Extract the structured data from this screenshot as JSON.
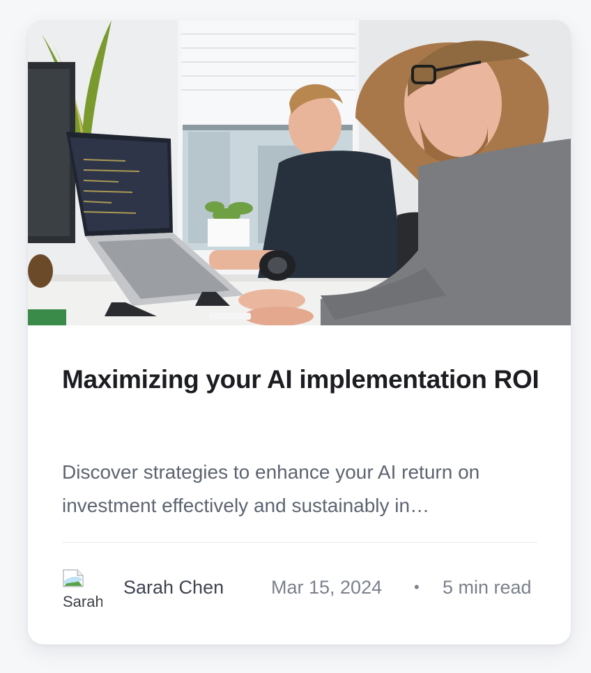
{
  "card": {
    "image_alt": "Two developers working at desks with laptops and monitors",
    "title": "Maximizing your AI implementation ROI",
    "excerpt": "Discover strategies to enhance your AI return on investment effectively and sustainably in…",
    "author": {
      "name": "Sarah Chen",
      "avatar_alt": "Sarah Chen"
    },
    "date": "Mar 15, 2024",
    "separator": "•",
    "read_time": "5 min read"
  },
  "colors": {
    "background": "#f6f7f9",
    "card": "#ffffff",
    "title": "#1c1d21",
    "excerpt": "#5d6470",
    "meta": "#7a808b",
    "author": "#3e4350"
  }
}
